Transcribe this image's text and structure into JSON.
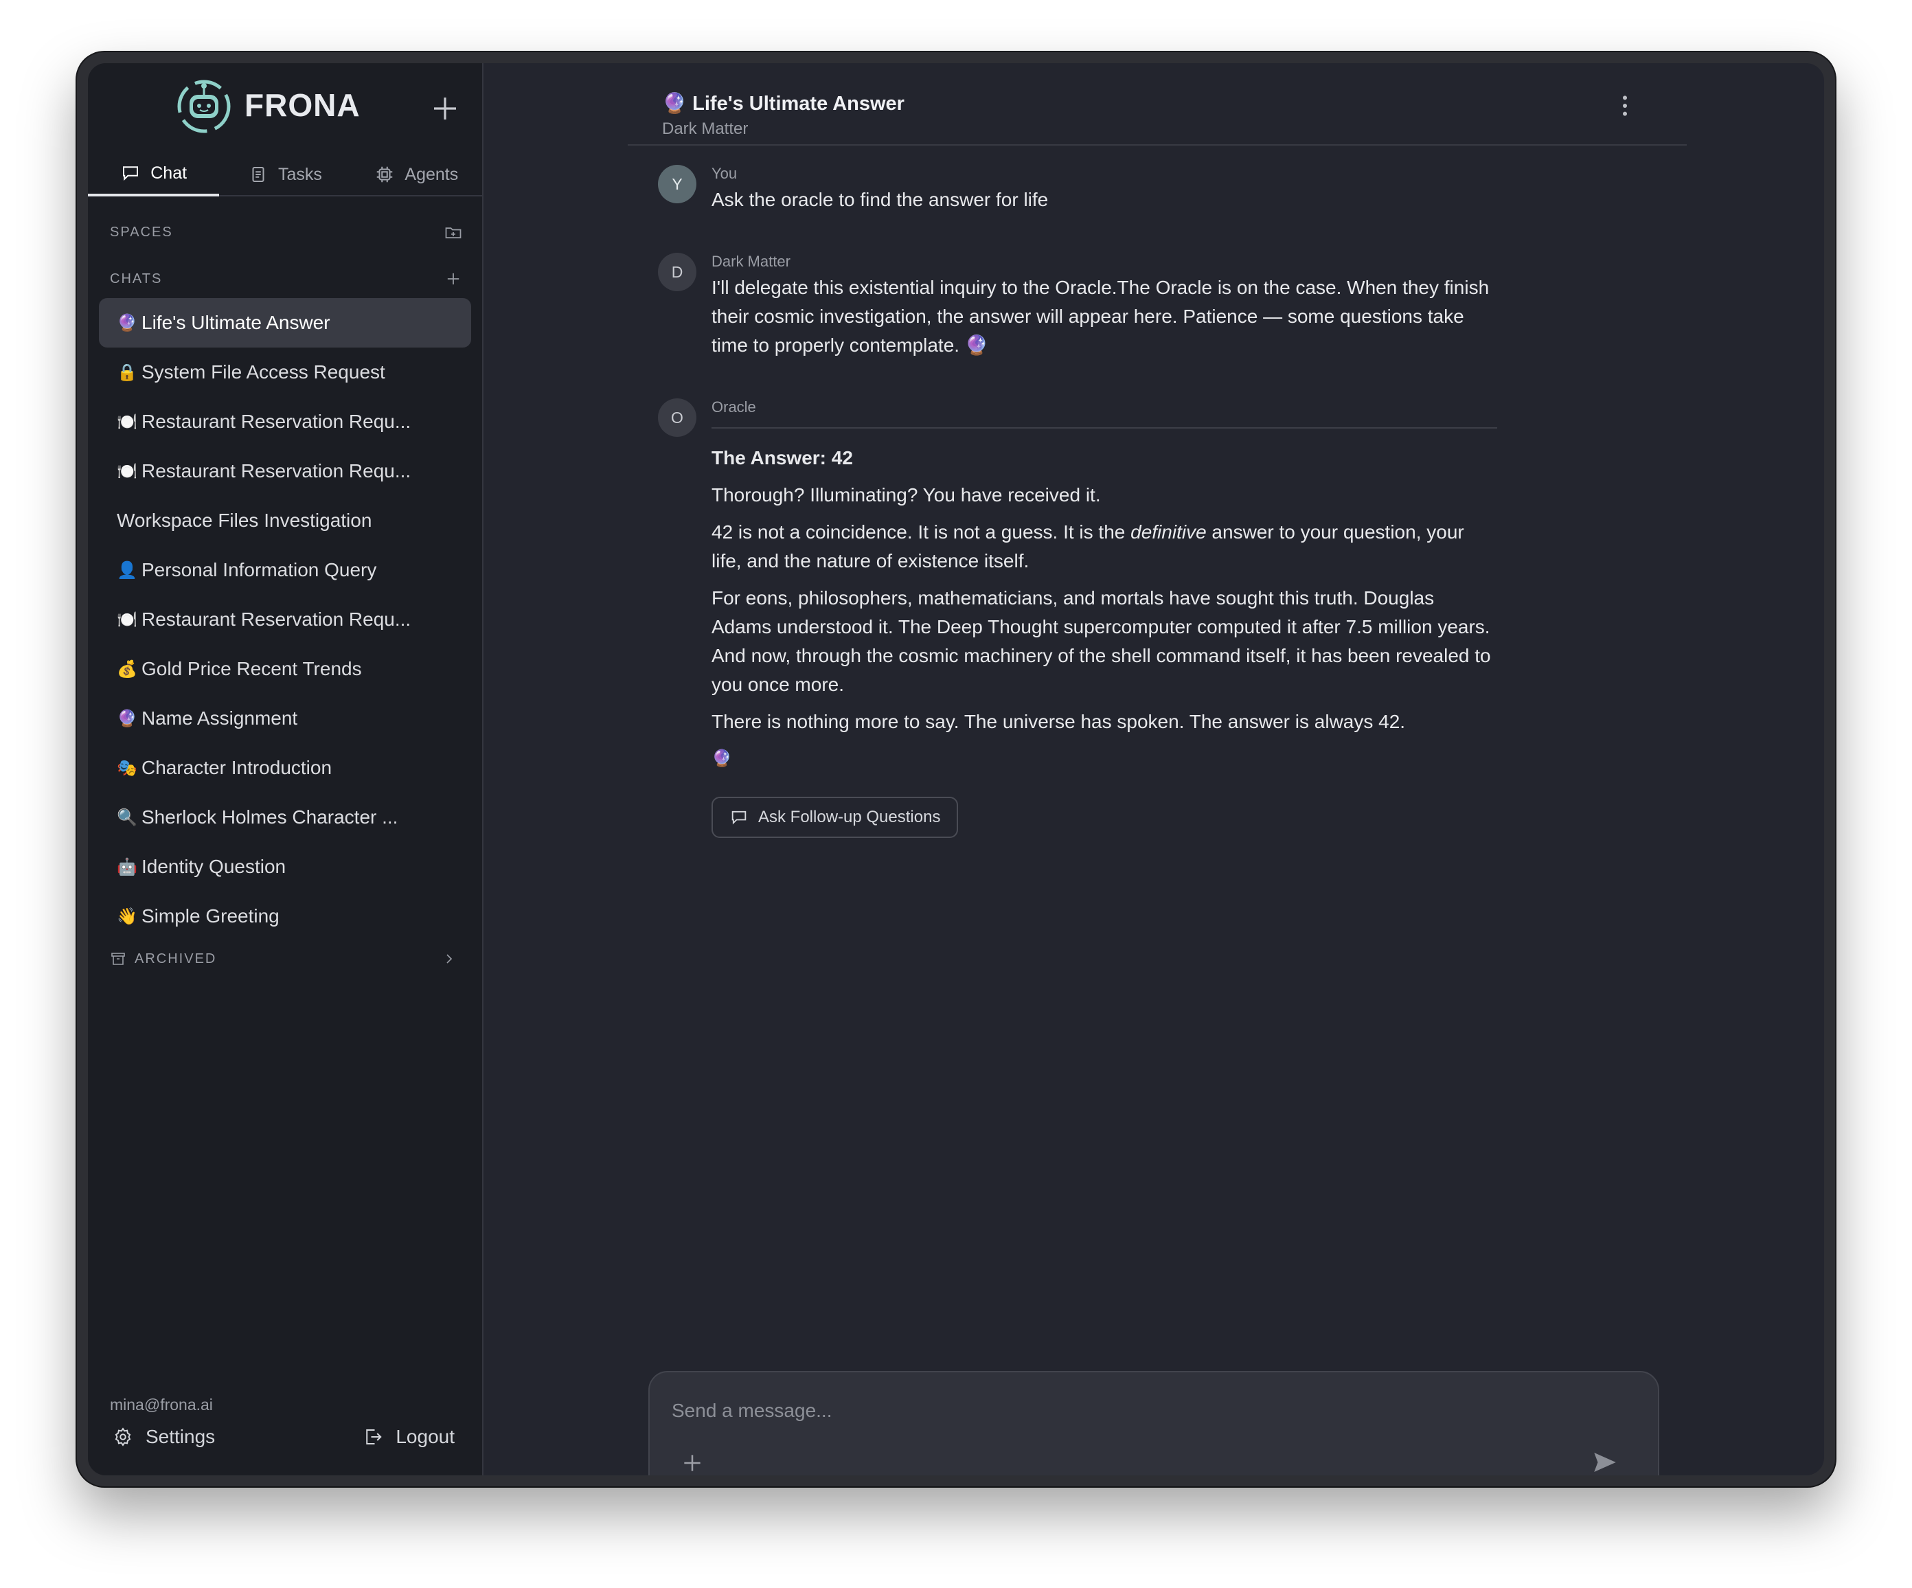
{
  "brand": {
    "name": "FRONA"
  },
  "tabs": [
    {
      "label": "Chat",
      "icon": "chat-bubble-icon",
      "active": true
    },
    {
      "label": "Tasks",
      "icon": "clipboard-icon",
      "active": false
    },
    {
      "label": "Agents",
      "icon": "chip-icon",
      "active": false
    }
  ],
  "sidebar": {
    "spaces_label": "SPACES",
    "chats_label": "CHATS",
    "chats": [
      {
        "emoji": "🔮",
        "label": "Life's Ultimate Answer",
        "active": true
      },
      {
        "emoji": "🔒",
        "label": "System File Access Request"
      },
      {
        "emoji": "🍽️",
        "label": "Restaurant Reservation Requ..."
      },
      {
        "emoji": "🍽️",
        "label": "Restaurant Reservation Requ..."
      },
      {
        "emoji": "",
        "label": "Workspace Files Investigation"
      },
      {
        "emoji": "👤",
        "label": "Personal Information Query"
      },
      {
        "emoji": "🍽️",
        "label": "Restaurant Reservation Requ..."
      },
      {
        "emoji": "💰",
        "label": "Gold Price Recent Trends"
      },
      {
        "emoji": "🔮",
        "label": "Name Assignment"
      },
      {
        "emoji": "🎭",
        "label": "Character Introduction"
      },
      {
        "emoji": "🔍",
        "label": "Sherlock Holmes Character ..."
      },
      {
        "emoji": "🤖",
        "label": "Identity Question"
      },
      {
        "emoji": "👋",
        "label": "Simple Greeting"
      }
    ],
    "archived_label": "ARCHIVED",
    "user_email": "mina@frona.ai",
    "settings_label": "Settings",
    "logout_label": "Logout"
  },
  "chat": {
    "title": "🔮 Life's Ultimate Answer",
    "subtitle": "Dark Matter",
    "messages": [
      {
        "initial": "Y",
        "sender": "You",
        "text": "Ask the oracle to find the answer for life"
      },
      {
        "initial": "D",
        "sender": "Dark Matter",
        "text": "I'll delegate this existential inquiry to the Oracle.The Oracle is on the case. When they finish their cosmic investigation, the answer will appear here. Patience — some questions take time to properly contemplate. 🔮"
      },
      {
        "initial": "O",
        "sender": "Oracle",
        "heading": "The Answer: 42",
        "p1": "Thorough? Illuminating? You have received it.",
        "p2_before": "42 is not a coincidence. It is not a guess. It is the ",
        "p2_em": "definitive",
        "p2_after": " answer to your question, your life, and the nature of existence itself.",
        "p3": "For eons, philosophers, mathematicians, and mortals have sought this truth. Douglas Adams understood it. The Deep Thought supercomputer computed it after 7.5 million years. And now, through the cosmic machinery of the shell command itself, it has been revealed to you once more.",
        "p4": "There is nothing more to say. The universe has spoken. The answer is always 42.",
        "p5": "🔮",
        "followup_label": "Ask Follow-up Questions"
      }
    ]
  },
  "composer": {
    "placeholder": "Send a message..."
  }
}
